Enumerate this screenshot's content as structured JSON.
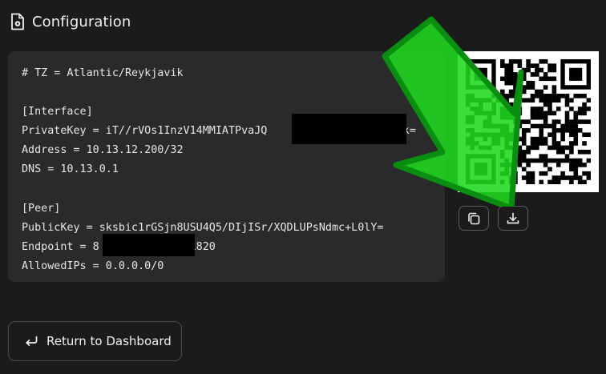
{
  "header": {
    "title": "Configuration",
    "icon": "file-gear-icon"
  },
  "config": {
    "lines": [
      "# TZ = Atlantic/Reykjavik",
      "",
      "[Interface]",
      "PrivateKey = iT//rVOs1InzV14MMIATPvaJQ                   N4k=",
      "Address = 10.13.12.200/32",
      "DNS = 10.13.0.1",
      "",
      "[Peer]",
      "PublicKey = sksbic1rGSjn8USU4Q5/DIjISr/XQDLUPsNdmc+L0lY=",
      "Endpoint = 8            :51820",
      "AllowedIPs = 0.0.0.0/0"
    ]
  },
  "qr": {
    "icon": "qr-code"
  },
  "actions": {
    "copy_icon": "copy-icon",
    "download_icon": "download-icon"
  },
  "annotation": {
    "color": "#16d816",
    "icon": "green-arrow"
  },
  "footer": {
    "return_label": "Return to Dashboard",
    "return_icon": "return-arrow-icon"
  }
}
